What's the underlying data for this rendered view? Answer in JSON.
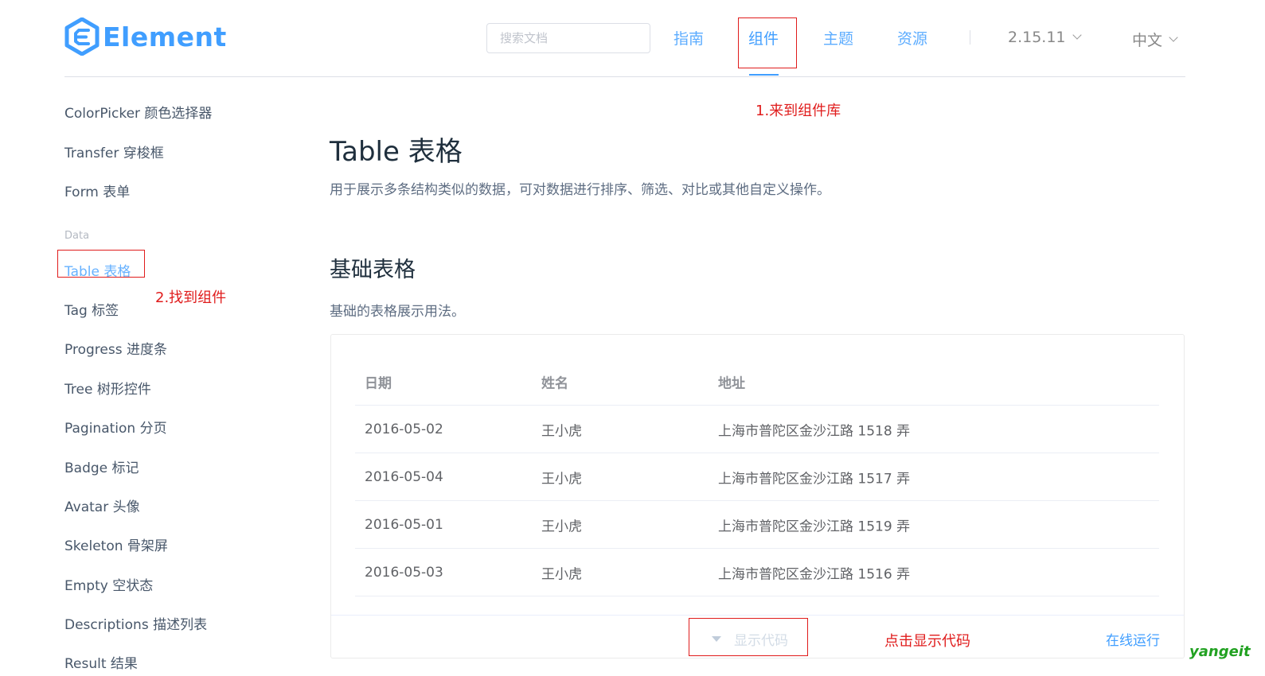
{
  "header": {
    "logo_text": "Element",
    "search_placeholder": "搜索文档",
    "nav": [
      {
        "label": "指南"
      },
      {
        "label": "组件"
      },
      {
        "label": "主题"
      },
      {
        "label": "资源"
      }
    ],
    "version": "2.15.11",
    "language": "中文"
  },
  "annotations": {
    "step1": "1.来到组件库",
    "step2": "2.找到组件",
    "step3": "点击显示代码"
  },
  "sidebar": {
    "items_top": [
      {
        "label": "ColorPicker 颜色选择器"
      },
      {
        "label": "Transfer 穿梭框"
      },
      {
        "label": "Form 表单"
      }
    ],
    "group_label": "Data",
    "items_data": [
      {
        "label": "Table 表格"
      },
      {
        "label": "Tag 标签"
      },
      {
        "label": "Progress 进度条"
      },
      {
        "label": "Tree 树形控件"
      },
      {
        "label": "Pagination 分页"
      },
      {
        "label": "Badge 标记"
      },
      {
        "label": "Avatar 头像"
      },
      {
        "label": "Skeleton 骨架屏"
      },
      {
        "label": "Empty 空状态"
      },
      {
        "label": "Descriptions 描述列表"
      },
      {
        "label": "Result 结果"
      }
    ]
  },
  "main": {
    "title": "Table 表格",
    "description": "用于展示多条结构类似的数据，可对数据进行排序、筛选、对比或其他自定义操作。",
    "section_title": "基础表格",
    "section_desc": "基础的表格展示用法。",
    "table": {
      "headers": [
        "日期",
        "姓名",
        "地址"
      ],
      "rows": [
        [
          "2016-05-02",
          "王小虎",
          "上海市普陀区金沙江路 1518 弄"
        ],
        [
          "2016-05-04",
          "王小虎",
          "上海市普陀区金沙江路 1517 弄"
        ],
        [
          "2016-05-01",
          "王小虎",
          "上海市普陀区金沙江路 1519 弄"
        ],
        [
          "2016-05-03",
          "王小虎",
          "上海市普陀区金沙江路 1516 弄"
        ]
      ]
    },
    "show_code": "显示代码",
    "run_online": "在线运行"
  },
  "watermark": "yangeit",
  "colors": {
    "primary": "#409eff",
    "annotation": "#e01c1c",
    "watermark": "#21a121"
  }
}
